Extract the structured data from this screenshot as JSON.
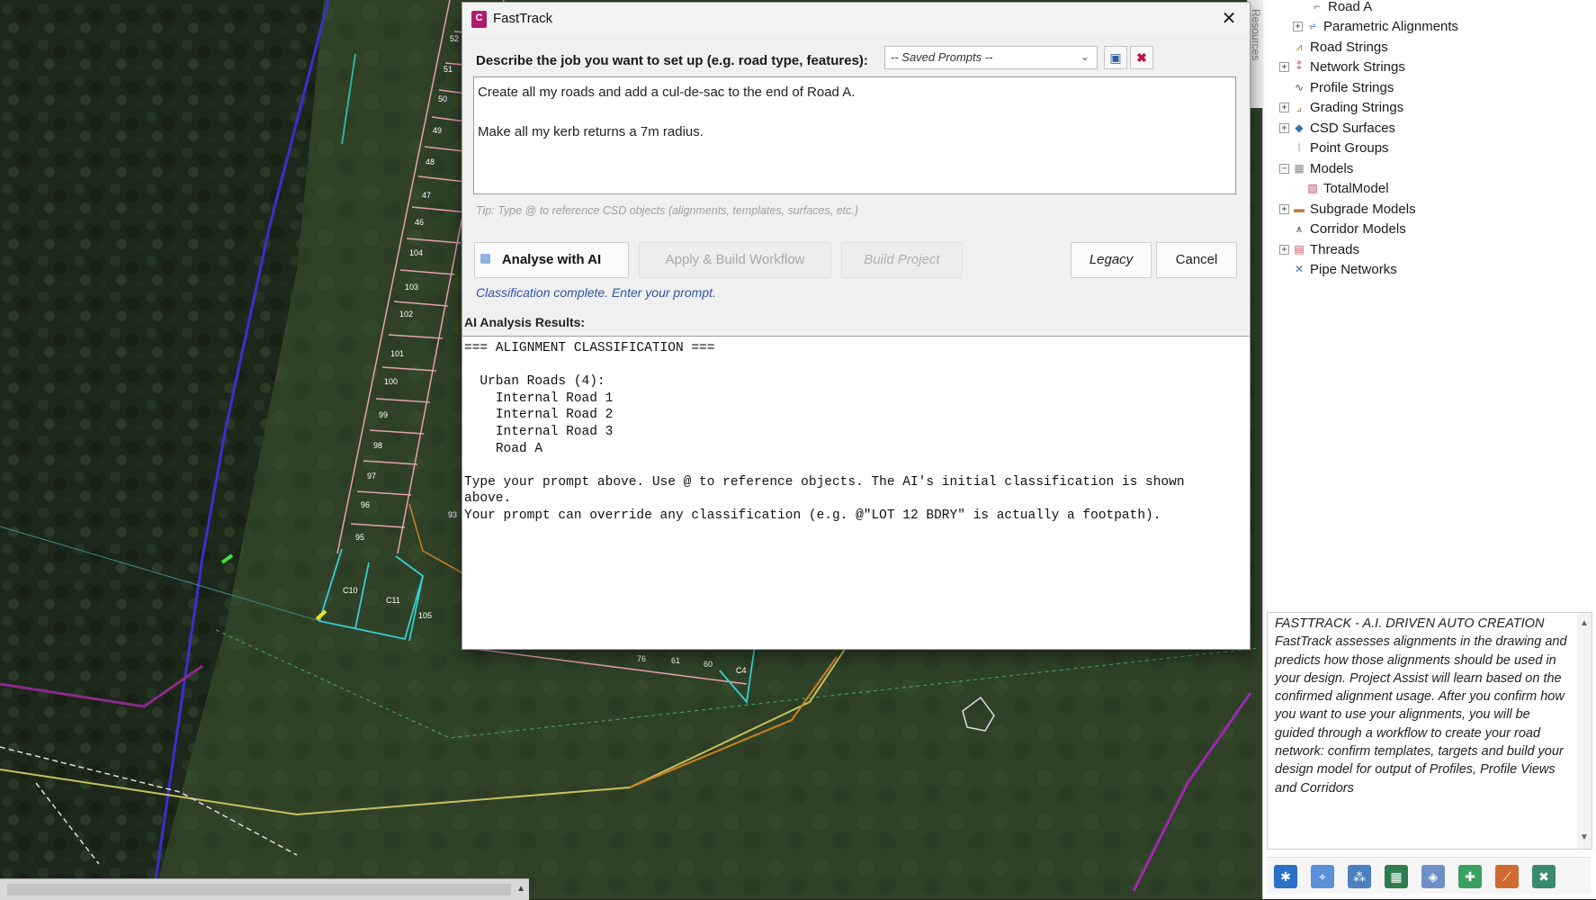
{
  "dialog": {
    "title": "FastTrack",
    "app_icon_letter": "C",
    "prompt_label": "Describe the job you want to set up (e.g. road type, features):",
    "saved_prompts": {
      "selected": "-- Saved Prompts --"
    },
    "prompt_text": "Create all my roads and add a cul-de-sac to the end of Road A.\n\nMake all my kerb returns a 7m radius.",
    "tip": "Tip: Type @ to reference CSD objects (alignments, templates, surfaces, etc.)",
    "buttons": {
      "analyse": "Analyse with AI",
      "apply": "Apply & Build Workflow",
      "build": "Build Project",
      "legacy": "Legacy",
      "cancel": "Cancel"
    },
    "status": "Classification complete. Enter your prompt.",
    "results_label": "AI Analysis Results:",
    "results_text": "=== ALIGNMENT CLASSIFICATION ===\n\n  Urban Roads (4):\n    Internal Road 1\n    Internal Road 2\n    Internal Road 3\n    Road A\n\nType your prompt above. Use @ to reference objects. The AI's initial classification is shown\nabove.\nYour prompt can override any classification (e.g. @\"LOT 12 BDRY\" is actually a footpath)."
  },
  "side_tab": "Resources",
  "tree": [
    {
      "label": "Road A",
      "depth": 2,
      "expander": "",
      "icon": "alignment-icon"
    },
    {
      "label": "Parametric Alignments",
      "depth": 1,
      "expander": "+",
      "icon": "parametric-alignment-icon"
    },
    {
      "label": "Road Strings",
      "depth": 1,
      "expander": "",
      "icon": "road-string-icon"
    },
    {
      "label": "Network Strings",
      "depth": 1,
      "expander": "+",
      "icon": "network-string-icon"
    },
    {
      "label": "Profile Strings",
      "depth": 1,
      "expander": "",
      "icon": "profile-string-icon"
    },
    {
      "label": "Grading Strings",
      "depth": 1,
      "expander": "+",
      "icon": "grading-string-icon"
    },
    {
      "label": "CSD Surfaces",
      "depth": 1,
      "expander": "+",
      "icon": "surface-icon"
    },
    {
      "label": "Point Groups",
      "depth": 1,
      "expander": "",
      "icon": "point-group-icon"
    },
    {
      "label": "Models",
      "depth": 1,
      "expander": "−",
      "icon": "model-icon"
    },
    {
      "label": "TotalModel",
      "depth": 2,
      "expander": "",
      "icon": "model-icon"
    },
    {
      "label": "Subgrade Models",
      "depth": 1,
      "expander": "+",
      "icon": "subgrade-model-icon"
    },
    {
      "label": "Corridor Models",
      "depth": 1,
      "expander": "",
      "icon": "corridor-model-icon"
    },
    {
      "label": "Threads",
      "depth": 1,
      "expander": "+",
      "icon": "thread-icon"
    },
    {
      "label": "Pipe Networks",
      "depth": 1,
      "expander": "",
      "icon": "pipe-network-icon"
    }
  ],
  "help": {
    "title": "FASTTRACK - A.I. DRIVEN AUTO CREATION",
    "body": "FastTrack assesses alignments in the drawing and predicts how those alignments should be used in your design. Project Assist will learn based on the confirmed alignment usage. After you confirm how you want to use your alignments, you will be guided through a workflow to create your road network: confirm templates, targets and build your design model for output of Profiles, Profile Views and Corridors"
  },
  "lot_labels": [
    "52",
    "51",
    "50",
    "49",
    "48",
    "47",
    "46",
    "104",
    "103",
    "102",
    "101",
    "100",
    "99",
    "98",
    "97",
    "96",
    "95",
    "93",
    "C10",
    "C11",
    "105",
    "76",
    "61",
    "60",
    "C4"
  ],
  "colors": {
    "accent": "#b01c6c",
    "status_text": "#2f55a8",
    "cad_background": "#1e2a1c"
  }
}
